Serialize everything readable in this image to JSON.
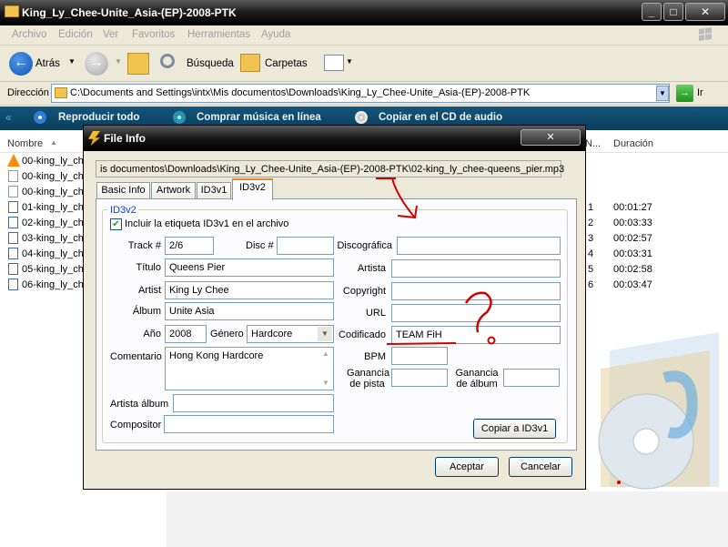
{
  "window": {
    "title": "King_Ly_Chee-Unite_Asia-(EP)-2008-PTK",
    "caption_min": "_",
    "caption_max": "□",
    "caption_close": "✕"
  },
  "menu": [
    "Archivo",
    "Edición",
    "Ver",
    "Favoritos",
    "Herramientas",
    "Ayuda"
  ],
  "toolbar": {
    "back_label": "Atrás",
    "search_label": "Búsqueda",
    "folders_label": "Carpetas"
  },
  "address": {
    "label": "Dirección",
    "value": "C:\\Documents and Settings\\intx\\Mis documentos\\Downloads\\King_Ly_Chee-Unite_Asia-(EP)-2008-PTK",
    "go_label": "Ir"
  },
  "tasks": {
    "play_all": "Reproducir todo",
    "buy_music": "Comprar música en línea",
    "burn_cd": "Copiar en el CD de audio"
  },
  "columns": {
    "name": "Nombre",
    "number": "N...",
    "duration": "Duración"
  },
  "files": [
    {
      "name": "00-king_ly_ch",
      "num": "",
      "dur": ""
    },
    {
      "name": "00-king_ly_ch",
      "num": "",
      "dur": ""
    },
    {
      "name": "00-king_ly_ch",
      "num": "",
      "dur": ""
    },
    {
      "name": "01-king_ly_ch",
      "num": "1",
      "dur": "00:01:27"
    },
    {
      "name": "02-king_ly_ch",
      "num": "2",
      "dur": "00:03:33"
    },
    {
      "name": "03-king_ly_ch",
      "num": "3",
      "dur": "00:02:57"
    },
    {
      "name": "04-king_ly_ch",
      "num": "4",
      "dur": "00:03:31"
    },
    {
      "name": "05-king_ly_ch",
      "num": "5",
      "dur": "00:02:58"
    },
    {
      "name": "06-king_ly_ch",
      "num": "6",
      "dur": "00:03:47"
    }
  ],
  "dialog": {
    "title": "File Info",
    "close": "✕",
    "path": "is documentos\\Downloads\\King_Ly_Chee-Unite_Asia-(EP)-2008-PTK\\02-king_ly_chee-queens_pier.mp3",
    "tabs": [
      "Basic Info",
      "Artwork",
      "ID3v1",
      "ID3v2"
    ],
    "group_label": "ID3v2",
    "include_id3v1_label": "Incluir la etiqueta ID3v1 en el archivo",
    "fields": {
      "track_label": "Track #",
      "track_value": "2/6",
      "disc_label": "Disc #",
      "disc_value": "",
      "title_label": "Título",
      "title_value": "Queens Pier",
      "artist_label": "Artist",
      "artist_value": "King Ly Chee",
      "album_label": "Álbum",
      "album_value": "Unite Asia",
      "year_label": "Año",
      "year_value": "2008",
      "genre_label": "Género",
      "genre_value": "Hardcore",
      "comment_label": "Comentario",
      "comment_value": "Hong Kong Hardcore",
      "album_artist_label": "Artista álbum",
      "album_artist_value": "",
      "composer_label": "Compositor",
      "composer_value": "",
      "label_label": "Discográfica",
      "label_value": "",
      "artista_label": "Artista",
      "artista_value": "",
      "copyright_label": "Copyright",
      "copyright_value": "",
      "url_label": "URL",
      "url_value": "",
      "encoded_label": "Codificado",
      "encoded_value": "TEAM FiH",
      "bpm_label": "BPM",
      "bpm_value": "",
      "track_gain_label_1": "Ganancia",
      "track_gain_label_2": "de pista",
      "album_gain_label_1": "Ganancia",
      "album_gain_label_2": "de álbum"
    },
    "copy_button": "Copiar a ID3v1",
    "ok_button": "Aceptar",
    "cancel_button": "Cancelar"
  },
  "annotation_color": "#d40000"
}
